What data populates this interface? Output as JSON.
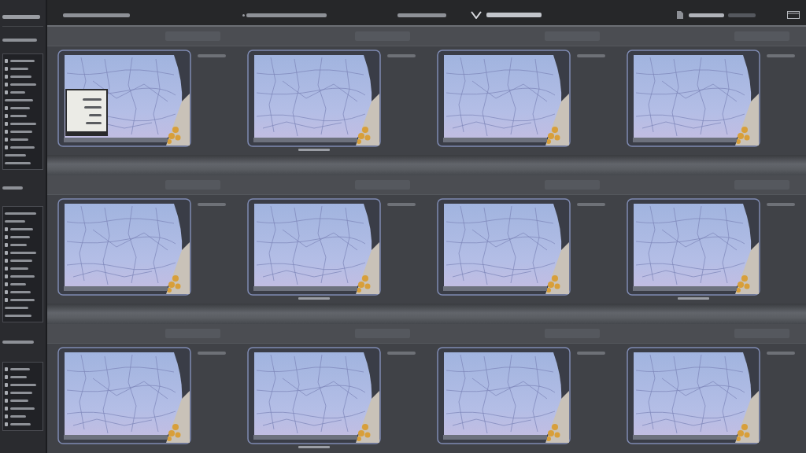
{
  "sidebar": {
    "sections": [
      {
        "rows": [
          {
            "icon": true
          },
          {
            "icon": true
          },
          {
            "icon": true
          },
          {
            "icon": true
          },
          {
            "icon": true
          },
          {
            "icon": false
          },
          {
            "icon": true
          },
          {
            "icon": true
          },
          {
            "icon": true
          },
          {
            "icon": true
          },
          {
            "icon": true
          },
          {
            "icon": true
          },
          {
            "icon": false
          },
          {
            "icon": false
          }
        ]
      },
      {
        "rows": [
          {
            "icon": false
          },
          {
            "icon": false
          },
          {
            "icon": true
          },
          {
            "icon": true
          },
          {
            "icon": true
          },
          {
            "icon": true
          },
          {
            "icon": true
          },
          {
            "icon": true
          },
          {
            "icon": true
          },
          {
            "icon": true
          },
          {
            "icon": true
          },
          {
            "icon": true
          },
          {
            "icon": false
          },
          {
            "icon": false
          }
        ]
      },
      {
        "rows": [
          {
            "icon": true
          },
          {
            "icon": true
          },
          {
            "icon": true
          },
          {
            "icon": true
          },
          {
            "icon": true
          },
          {
            "icon": true
          },
          {
            "icon": true
          },
          {
            "icon": true
          }
        ]
      }
    ]
  },
  "gallery": {
    "rows": [
      {
        "tiles": [
          {
            "inset": true,
            "caption": false
          },
          {
            "inset": false,
            "caption": true
          },
          {
            "inset": false,
            "caption": false
          },
          {
            "inset": false,
            "caption": false
          }
        ]
      },
      {
        "tiles": [
          {
            "inset": false,
            "caption": false
          },
          {
            "inset": false,
            "caption": true
          },
          {
            "inset": false,
            "caption": false
          },
          {
            "inset": false,
            "caption": true
          }
        ]
      },
      {
        "tiles": [
          {
            "inset": false,
            "caption": false
          },
          {
            "inset": false,
            "caption": true
          },
          {
            "inset": false,
            "caption": false
          },
          {
            "inset": false,
            "caption": false
          }
        ]
      }
    ]
  }
}
